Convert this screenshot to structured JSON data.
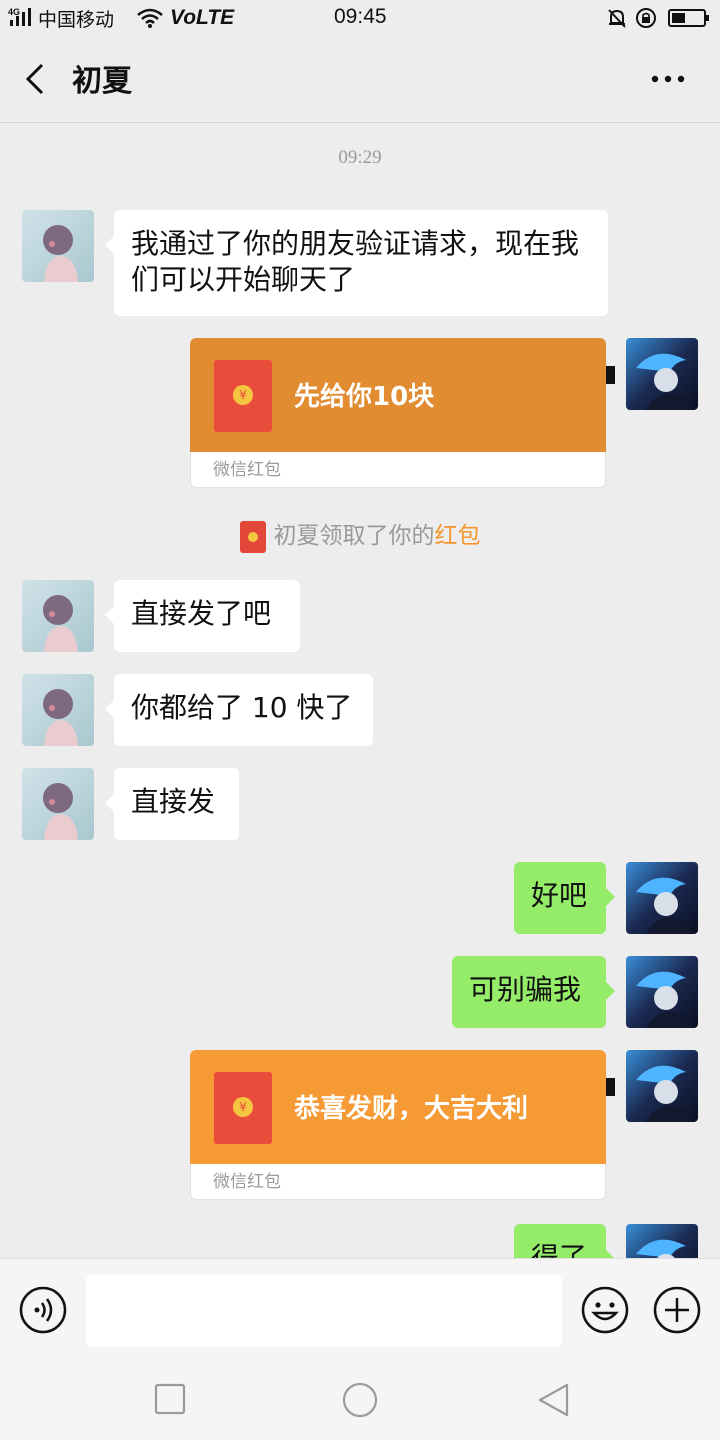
{
  "status_bar": {
    "network": "4G",
    "carrier": "中国移动",
    "volte": "VoLTE",
    "time": "09:45"
  },
  "header": {
    "title": "初夏"
  },
  "chat": {
    "timestamp": "09:29",
    "messages": [
      {
        "side": "left",
        "text": "我通过了你的朋友验证请求，现在我们可以开始聊天了"
      },
      {
        "side": "right",
        "type": "red_packet",
        "text": "先给你10块",
        "footer": "微信红包",
        "color": "#e28c32"
      },
      {
        "type": "notice",
        "prefix": "初夏领取了你的",
        "highlight": "红包"
      },
      {
        "side": "left",
        "text": "直接发了吧"
      },
      {
        "side": "left",
        "text": "你都给了 10 快了"
      },
      {
        "side": "left",
        "text": "直接发"
      },
      {
        "side": "right",
        "text": "好吧"
      },
      {
        "side": "right",
        "text": "可别骗我"
      },
      {
        "side": "right",
        "type": "red_packet",
        "text": "恭喜发财，大吉大利",
        "footer": "微信红包",
        "color": "#f59a35"
      },
      {
        "side": "right",
        "text": "得了"
      }
    ]
  },
  "colors": {
    "background": "#ededed",
    "bubble_self": "#95ec69",
    "bubble_other": "#ffffff",
    "red_packet_opened": "#e28c32",
    "red_packet_unopened": "#f59a35",
    "highlight": "#f5962d"
  },
  "icons": {
    "back": "chevron-left-icon",
    "more": "more-dots-icon",
    "voice": "voice-icon",
    "emoji": "emoji-icon",
    "plus": "plus-icon"
  }
}
